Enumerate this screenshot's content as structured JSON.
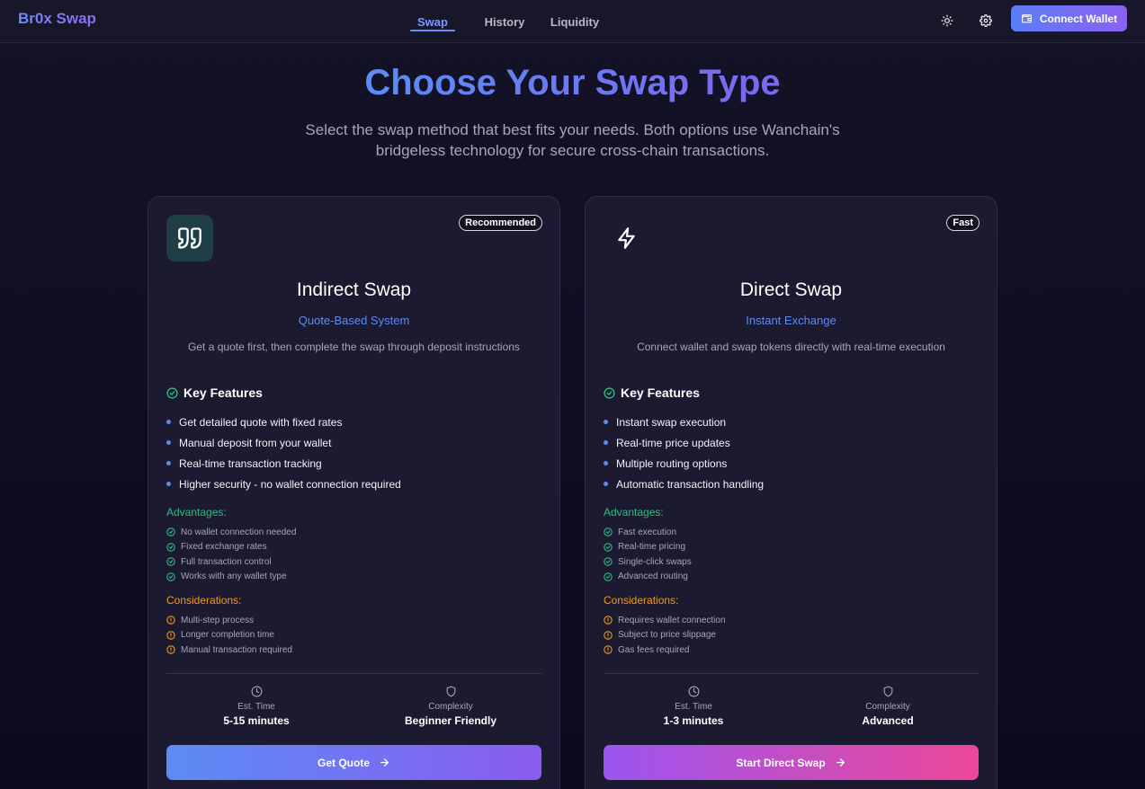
{
  "header": {
    "brand": "Br0x Swap",
    "tabs": [
      {
        "label": "Swap",
        "active": true
      },
      {
        "label": "History",
        "active": false
      },
      {
        "label": "Liquidity",
        "active": false
      }
    ],
    "theme_icon": "sun-icon",
    "settings_icon": "gear-icon",
    "connect_wallet": "Connect Wallet"
  },
  "hero": {
    "title": "Choose Your Swap Type",
    "subtitle": "Select the swap method that best fits your needs. Both options use Wanchain's bridgeless technology for secure cross-chain transactions."
  },
  "cards": [
    {
      "badge": "Recommended",
      "icon": "quote-icon",
      "title": "Indirect Swap",
      "subtitle": "Quote-Based System",
      "description": "Get a quote first, then complete the swap through deposit instructions",
      "features_title": "Key Features",
      "features": [
        "Get detailed quote with fixed rates",
        "Manual deposit from your wallet",
        "Real-time transaction tracking",
        "Higher security - no wallet connection required"
      ],
      "advantages_title": "Advantages:",
      "advantages": [
        "No wallet connection needed",
        "Fixed exchange rates",
        "Full transaction control",
        "Works with any wallet type"
      ],
      "considerations_title": "Considerations:",
      "considerations": [
        "Multi-step process",
        "Longer completion time",
        "Manual transaction required"
      ],
      "time_label": "Est. Time",
      "time_value": "5-15 minutes",
      "complexity_label": "Complexity",
      "complexity_value": "Beginner Friendly",
      "button": "Get Quote"
    },
    {
      "badge": "Fast",
      "icon": "lightning-icon",
      "title": "Direct Swap",
      "subtitle": "Instant Exchange",
      "description": "Connect wallet and swap tokens directly with real-time execution",
      "features_title": "Key Features",
      "features": [
        "Instant swap execution",
        "Real-time price updates",
        "Multiple routing options",
        "Automatic transaction handling"
      ],
      "advantages_title": "Advantages:",
      "advantages": [
        "Fast execution",
        "Real-time pricing",
        "Single-click swaps",
        "Advanced routing"
      ],
      "considerations_title": "Considerations:",
      "considerations": [
        "Requires wallet connection",
        "Subject to price slippage",
        "Gas fees required"
      ],
      "time_label": "Est. Time",
      "time_value": "1-3 minutes",
      "complexity_label": "Complexity",
      "complexity_value": "Advanced",
      "button": "Start Direct Swap"
    }
  ],
  "colors": {
    "accent_blue": "#5b8cf5",
    "accent_purple": "#8b5cf6",
    "advantage_green": "#2ebd85",
    "consideration_orange": "#f09a1a",
    "direct_button_pink": "#ec4899"
  }
}
